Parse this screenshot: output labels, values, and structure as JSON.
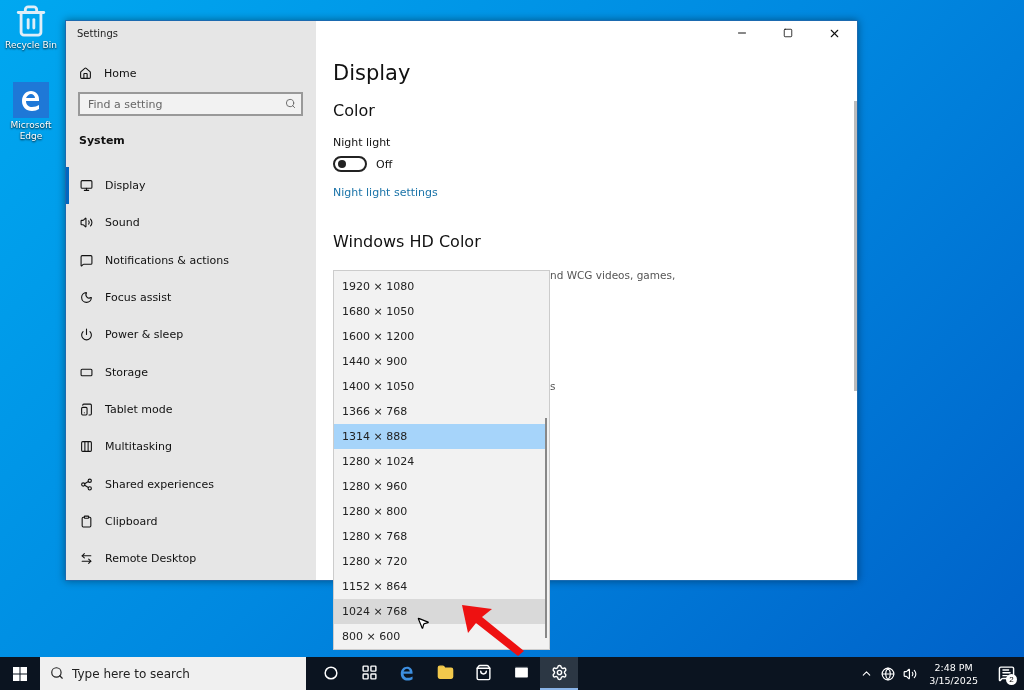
{
  "desktop_icons": [
    {
      "label": "Recycle Bin",
      "kind": "bin"
    },
    {
      "label": "Microsoft Edge",
      "kind": "edge"
    }
  ],
  "window": {
    "title": "Settings"
  },
  "sidebar": {
    "home": "Home",
    "search": {
      "placeholder": "Find a setting"
    },
    "section": "System",
    "items": [
      {
        "label": "Display",
        "selected": true
      },
      {
        "label": "Sound",
        "selected": false
      },
      {
        "label": "Notifications & actions",
        "selected": false
      },
      {
        "label": "Focus assist",
        "selected": false
      },
      {
        "label": "Power & sleep",
        "selected": false
      },
      {
        "label": "Storage",
        "selected": false
      },
      {
        "label": "Tablet mode",
        "selected": false
      },
      {
        "label": "Multitasking",
        "selected": false
      },
      {
        "label": "Shared experiences",
        "selected": false
      },
      {
        "label": "Clipboard",
        "selected": false
      },
      {
        "label": "Remote Desktop",
        "selected": false
      }
    ]
  },
  "content": {
    "title": "Display",
    "color_heading": "Color",
    "night_light": {
      "label": "Night light",
      "on": false,
      "state": "Off"
    },
    "night_light_link": "Night light settings",
    "hd_heading": "Windows HD Color",
    "hd_text": "nd WCG videos, games,",
    "hd_text_2": "s"
  },
  "resolution_dropdown": {
    "options": [
      {
        "label": "1920 × 1080",
        "selected": false,
        "hovered": false
      },
      {
        "label": "1680 × 1050",
        "selected": false,
        "hovered": false
      },
      {
        "label": "1600 × 1200",
        "selected": false,
        "hovered": false
      },
      {
        "label": "1440 × 900",
        "selected": false,
        "hovered": false
      },
      {
        "label": "1400 × 1050",
        "selected": false,
        "hovered": false
      },
      {
        "label": "1366 × 768",
        "selected": false,
        "hovered": false
      },
      {
        "label": "1314 × 888",
        "selected": true,
        "hovered": false
      },
      {
        "label": "1280 × 1024",
        "selected": false,
        "hovered": false
      },
      {
        "label": "1280 × 960",
        "selected": false,
        "hovered": false
      },
      {
        "label": "1280 × 800",
        "selected": false,
        "hovered": false
      },
      {
        "label": "1280 × 768",
        "selected": false,
        "hovered": false
      },
      {
        "label": "1280 × 720",
        "selected": false,
        "hovered": false
      },
      {
        "label": "1152 × 864",
        "selected": false,
        "hovered": false
      },
      {
        "label": "1024 × 768",
        "selected": false,
        "hovered": true
      },
      {
        "label": "800 × 600",
        "selected": false,
        "hovered": false
      }
    ]
  },
  "taskbar": {
    "search": {
      "placeholder": "Type here to search"
    },
    "apps": [
      {
        "kind": "cortana",
        "active": false
      },
      {
        "kind": "taskview",
        "active": false
      },
      {
        "kind": "edge",
        "active": false
      },
      {
        "kind": "explorer",
        "active": false
      },
      {
        "kind": "store",
        "active": false
      },
      {
        "kind": "mail",
        "active": false
      },
      {
        "kind": "settings",
        "active": true
      }
    ],
    "time": "2:48 PM",
    "date": "3/15/2025",
    "notification_count": "2"
  }
}
